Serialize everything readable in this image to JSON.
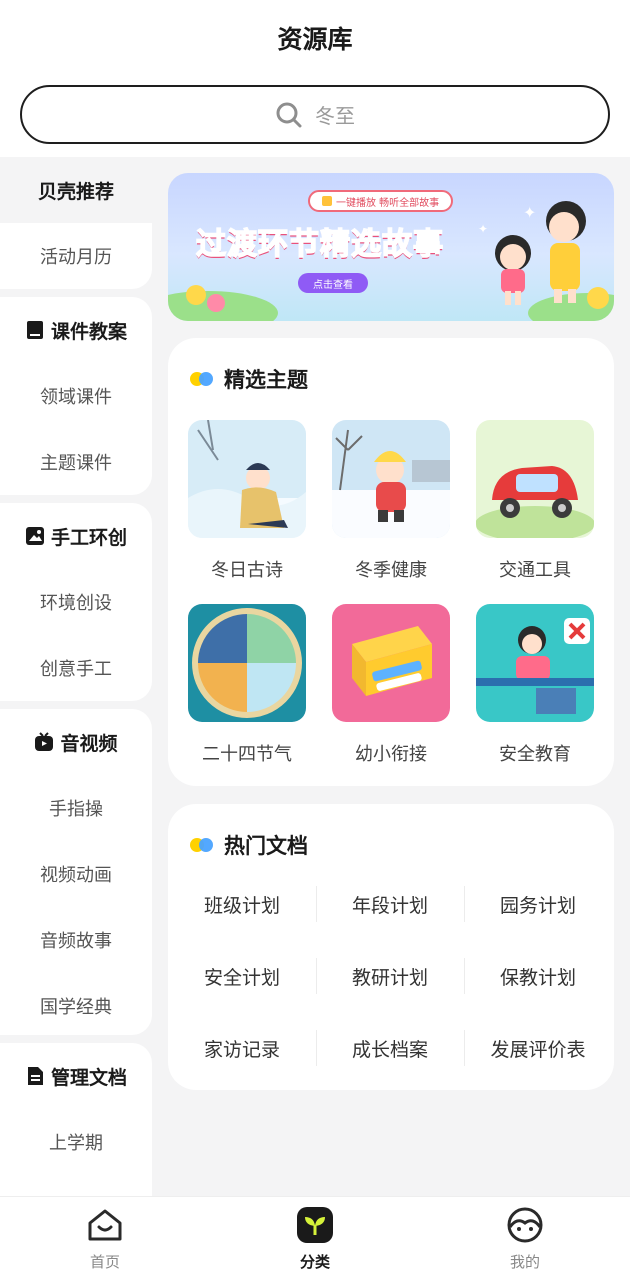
{
  "header": {
    "title": "资源库"
  },
  "search": {
    "placeholder": "冬至"
  },
  "sidebar": {
    "groups": [
      {
        "items": [
          "贝壳推荐",
          "活动月历"
        ]
      },
      {
        "title": "课件教案",
        "items": [
          "领域课件",
          "主题课件"
        ]
      },
      {
        "title": "手工环创",
        "items": [
          "环境创设",
          "创意手工"
        ]
      },
      {
        "title": "音视频",
        "items": [
          "手指操",
          "视频动画",
          "音频故事",
          "国学经典"
        ]
      },
      {
        "title": "管理文档",
        "items": [
          "上学期"
        ]
      }
    ]
  },
  "banner": {
    "pill": "一键播放 畅听全部故事",
    "title": "过渡环节精选故事",
    "button": "点击查看"
  },
  "featured": {
    "title": "精选主题",
    "topics": [
      "冬日古诗",
      "冬季健康",
      "交通工具",
      "二十四节气",
      "幼小衔接",
      "安全教育"
    ]
  },
  "docs": {
    "title": "热门文档",
    "items": [
      "班级计划",
      "年段计划",
      "园务计划",
      "安全计划",
      "教研计划",
      "保教计划",
      "家访记录",
      "成长档案",
      "发展评价表"
    ]
  },
  "tabbar": {
    "tabs": [
      "首页",
      "分类",
      "我的"
    ],
    "active": 1
  },
  "colors": {
    "accent": "#d6f23a",
    "dot_yellow": "#ffd100",
    "dot_blue": "#4aa3ff",
    "active_tab": "#1a1a1a"
  }
}
